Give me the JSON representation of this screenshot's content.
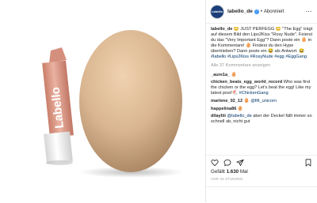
{
  "photo": {
    "lipstick_brand": "Labello",
    "colors": {
      "cap": "#f1f1f1",
      "body_top": "#e4a592",
      "body_bottom": "#c97e6a",
      "egg": "#d9b690"
    }
  },
  "post": {
    "username": "labello_de",
    "verified_mark": "✓",
    "separator": "•",
    "follow_label": "Abonniert",
    "more_icon": "⋯",
    "caption_user": "labello_de",
    "caption_text": " 😳 JUST PERFEGG 😳 \"The Egg\" trägt auf diesem Bild den Lips2Kiss \"Rosy Nude\". Feierst du das \"Very Important Egg\"? Dann poste ein 🥚 in die Kommentare! 🥚 Findest du den Hype übertrieben? Dann poste ein 😂 als Antwort. 😂 ",
    "caption_tags": "#labello #Lips2Kiss #RosyNude #egg #EggGang",
    "more_comments_label": "Alle 37 Kommentare anzeigen",
    "comments": [
      {
        "user": "_aure1a_",
        "text": " 🥚"
      },
      {
        "user": "chicken_beats_egg_world_record",
        "text": " Who was first the chicken or the egg? Let's beat the egg! Like my latest post!🐔 ",
        "tag": "#ChickenGang"
      },
      {
        "user": "marlene_02_12",
        "text": " 🥚 ",
        "tag": "@fifi_unicorn"
      },
      {
        "user": "happelina86",
        "text": " 🥚"
      },
      {
        "user": "dilayliii",
        "text": " ",
        "tag": "@labello_de",
        "text2": " aber der Deckel fällt immer so schnell ab, nicht gut"
      }
    ],
    "likes_prefix": "Gefällt ",
    "likes_count": "1.630",
    "likes_suffix": " Mal",
    "timestamp": "VOR 34 STUNDEN"
  },
  "icons": {
    "like": "heart-icon",
    "comment": "comment-icon",
    "share": "share-icon",
    "save": "bookmark-icon"
  }
}
